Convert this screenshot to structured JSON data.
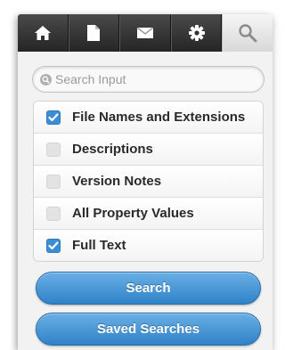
{
  "tabs": [
    {
      "icon": "home-icon",
      "active": false
    },
    {
      "icon": "document-icon",
      "active": false
    },
    {
      "icon": "mail-icon",
      "active": false
    },
    {
      "icon": "gear-icon",
      "active": false
    },
    {
      "icon": "search-icon",
      "active": true
    }
  ],
  "search": {
    "placeholder": "Search Input",
    "icon": "search-icon"
  },
  "options": [
    {
      "label": "File Names and Extensions",
      "checked": true
    },
    {
      "label": "Descriptions",
      "checked": false
    },
    {
      "label": "Version Notes",
      "checked": false
    },
    {
      "label": "All Property Values",
      "checked": false
    },
    {
      "label": "Full Text",
      "checked": true
    }
  ],
  "buttons": {
    "search_label": "Search",
    "saved_searches_label": "Saved Searches"
  },
  "colors": {
    "accent": "#3b8ed6",
    "tabbar_dark": "#2f2f2f",
    "tab_active": "#e6e6e6"
  }
}
